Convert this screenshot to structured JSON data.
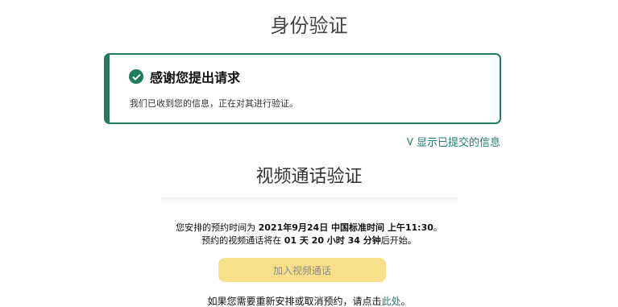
{
  "header": {
    "title": "身份验证"
  },
  "success": {
    "title": "感谢您提出请求",
    "message": "我们已收到您的信息，正在对其进行验证。"
  },
  "toggle": {
    "chevron": "V",
    "label": "显示已提交的信息"
  },
  "video": {
    "title": "视频通话验证",
    "line1_prefix": "您安排的预约时间为 ",
    "appointment": "2021年9月24日 中国标准时间 上午11:30",
    "line1_suffix": "。",
    "line2_prefix": "预约的视频通话将在 ",
    "countdown": "01 天 20 小时 34 分钟",
    "line2_suffix": "后开始。",
    "join_label": "加入视频通话",
    "reschedule_prefix": "如果您需要重新安排或取消预约，请点击",
    "reschedule_link": "此处",
    "reschedule_suffix": "。"
  },
  "colors": {
    "accent": "#1e7d5f",
    "link": "#1e7d72",
    "button": "#f7e089"
  },
  "icons": {
    "success": "check-circle-icon"
  }
}
